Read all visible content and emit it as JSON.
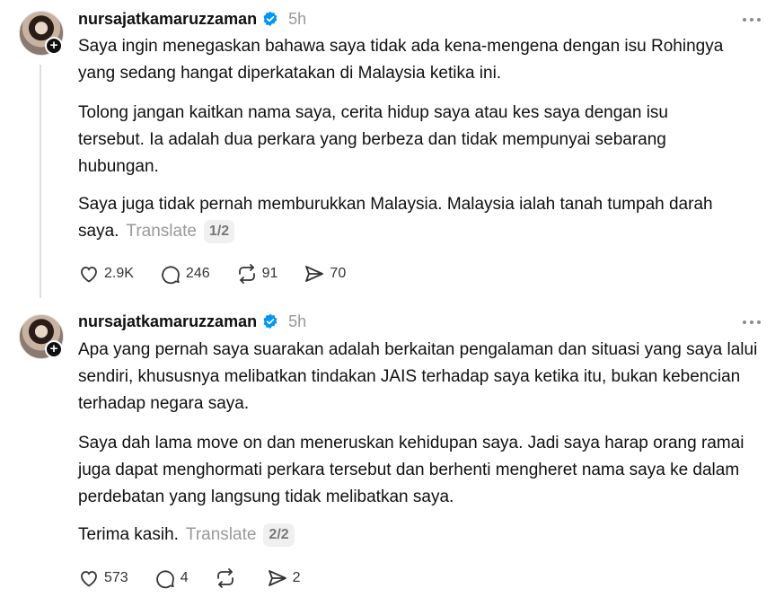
{
  "posts": [
    {
      "username": "nursajatkamaruzzaman",
      "time": "5h",
      "paragraphs": [
        "Saya ingin menegaskan bahawa saya tidak ada kena-mengena dengan isu Rohingya yang sedang hangat diperkatakan di Malaysia ketika ini.",
        "Tolong jangan kaitkan nama saya, cerita hidup saya atau kes saya dengan isu tersebut. Ia adalah dua perkara yang berbeza dan tidak mempunyai sebarang hubungan.",
        "Saya juga tidak pernah memburukkan Malaysia. Malaysia ialah tanah tumpah darah saya."
      ],
      "translate": "Translate",
      "page": "1/2",
      "likes": "2.9K",
      "replies": "246",
      "reposts": "91",
      "shares": "70"
    },
    {
      "username": "nursajatkamaruzzaman",
      "time": "5h",
      "paragraphs": [
        "Apa yang pernah saya suarakan adalah berkaitan pengalaman dan situasi yang saya lalui sendiri, khususnya melibatkan tindakan JAIS terhadap saya ketika itu, bukan kebencian terhadap negara saya.",
        "Saya dah lama move on dan meneruskan kehidupan saya. Jadi saya harap orang ramai juga dapat menghormati perkara tersebut dan berhenti mengheret nama saya ke dalam perdebatan yang langsung tidak melibatkan saya.",
        "Terima kasih."
      ],
      "translate": "Translate",
      "page": "2/2",
      "likes": "573",
      "replies": "4",
      "reposts": "",
      "shares": "2"
    }
  ],
  "icons": {
    "verified": "verified-badge-icon",
    "more": "more-options-icon",
    "like": "heart-icon",
    "reply": "comment-icon",
    "repost": "repost-icon",
    "share": "share-icon"
  },
  "colors": {
    "verified": "#0095f6",
    "muted": "#999999",
    "text": "#101010"
  }
}
